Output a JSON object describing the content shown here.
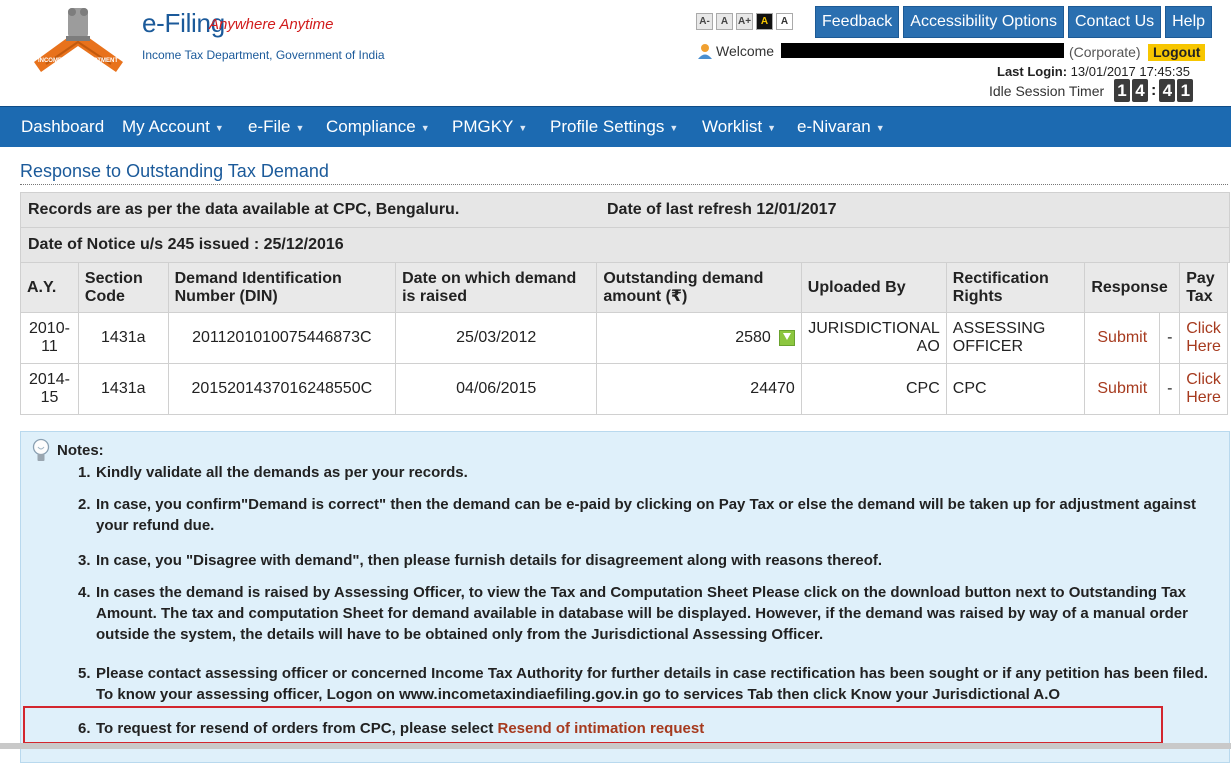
{
  "brand": {
    "title": "e-Filing",
    "tagline": "Anywhere Anytime",
    "subtitle": "Income Tax Department, Government of India"
  },
  "font_tools": [
    "A-",
    "A",
    "A+",
    "A",
    "A"
  ],
  "top_buttons": [
    "Feedback",
    "Accessibility Options",
    "Contact Us",
    "Help"
  ],
  "user": {
    "welcome": "Welcome",
    "role": "(Corporate)",
    "logout": "Logout",
    "last_login_label": "Last Login:",
    "last_login_value": "13/01/2017 17:45:35",
    "idle_label": "Idle Session Timer",
    "timer_digits": [
      "1",
      "4",
      "4",
      "1"
    ]
  },
  "nav": {
    "items": [
      {
        "label": "Dashboard",
        "dropdown": false
      },
      {
        "label": "My Account",
        "dropdown": true
      },
      {
        "label": "e-File",
        "dropdown": true
      },
      {
        "label": "Compliance",
        "dropdown": true
      },
      {
        "label": "PMGKY",
        "dropdown": true
      },
      {
        "label": "Profile Settings",
        "dropdown": true
      },
      {
        "label": "Worklist",
        "dropdown": true
      },
      {
        "label": "e-Nivaran",
        "dropdown": true
      }
    ]
  },
  "page": {
    "title": "Response to Outstanding Tax Demand",
    "records_note": "Records are as per the data available at CPC, Bengaluru.",
    "refresh": "Date of last refresh 12/01/2017",
    "notice": "Date of Notice u/s 245 issued : 25/12/2016"
  },
  "table": {
    "headers": {
      "ay": "A.Y.",
      "section_l1": "Section",
      "section_l2": "Code",
      "din_l1": "Demand Identification",
      "din_l2": "Number (DIN)",
      "date_l1": "Date on which demand",
      "date_l2": "is raised",
      "amt_l1": "Outstanding demand",
      "amt_l2": "amount (₹)",
      "uploaded": "Uploaded By",
      "rect_l1": "Rectification",
      "rect_l2": "Rights",
      "response": "Response",
      "pay_l1": "Pay",
      "pay_l2": "Tax"
    },
    "rows": [
      {
        "ay_l1": "2010-",
        "ay_l2": "11",
        "section": "1431a",
        "din": "2011201010075446873C",
        "date": "25/03/2012",
        "amount": "2580",
        "uploaded_l1": "JURISDICTIONAL",
        "uploaded_l2": "AO",
        "rect_l1": "ASSESSING",
        "rect_l2": "OFFICER",
        "response": "Submit",
        "dash": "-",
        "pay_l1": "Click",
        "pay_l2": "Here"
      },
      {
        "ay_l1": "2014-",
        "ay_l2": "15",
        "section": "1431a",
        "din": "2015201437016248550C",
        "date": "04/06/2015",
        "amount": "24470",
        "uploaded_l1": "CPC",
        "uploaded_l2": "",
        "rect_l1": "CPC",
        "rect_l2": "",
        "response": "Submit",
        "dash": "-",
        "pay_l1": "Click",
        "pay_l2": "Here"
      }
    ]
  },
  "notes": {
    "heading": "Notes:",
    "items": [
      {
        "num": "1.",
        "text": "Kindly validate all the demands as per your records."
      },
      {
        "num": "2.",
        "text": "In case, you confirm\"Demand is correct\" then the demand can be e-paid by clicking on Pay Tax or else the demand will be taken up for adjustment against your refund due."
      },
      {
        "num": "3.",
        "text": "In case, you \"Disagree with demand\", then please furnish details for disagreement along with reasons thereof."
      },
      {
        "num": "4.",
        "text": "In cases the demand is raised by Assessing Officer, to view the Tax and Computation Sheet Please click on the download button next to Outstanding Tax Amount. The tax and computation Sheet for demand available in database will be displayed. However, if the demand was raised by way of a manual order outside the system, the details will have to be obtained only from the Jurisdictional Assessing Officer."
      },
      {
        "num": "5.",
        "text": "Please contact assessing officer or concerned Income Tax Authority for further details in case rectification has been sought or if any petition has been filed. To know your assessing officer, Logon on www.incometaxindiaefiling.gov.in go to services Tab then click Know your Jurisdictional A.O"
      },
      {
        "num": "6.",
        "text": "To request for resend of orders from CPC, please select ",
        "link": "Resend of intimation request"
      }
    ]
  },
  "colors": {
    "nav_bg": "#1c6ab1",
    "brand_blue": "#1b5a9a",
    "link_red": "#a63a1e",
    "logout_yellow": "#f7c600",
    "notes_bg": "#dff0fa",
    "highlight_red": "#d3262e"
  },
  "icons": [
    "emblem-logo",
    "user-icon",
    "bulb-icon",
    "download-icon",
    "caret-down-icon"
  ]
}
